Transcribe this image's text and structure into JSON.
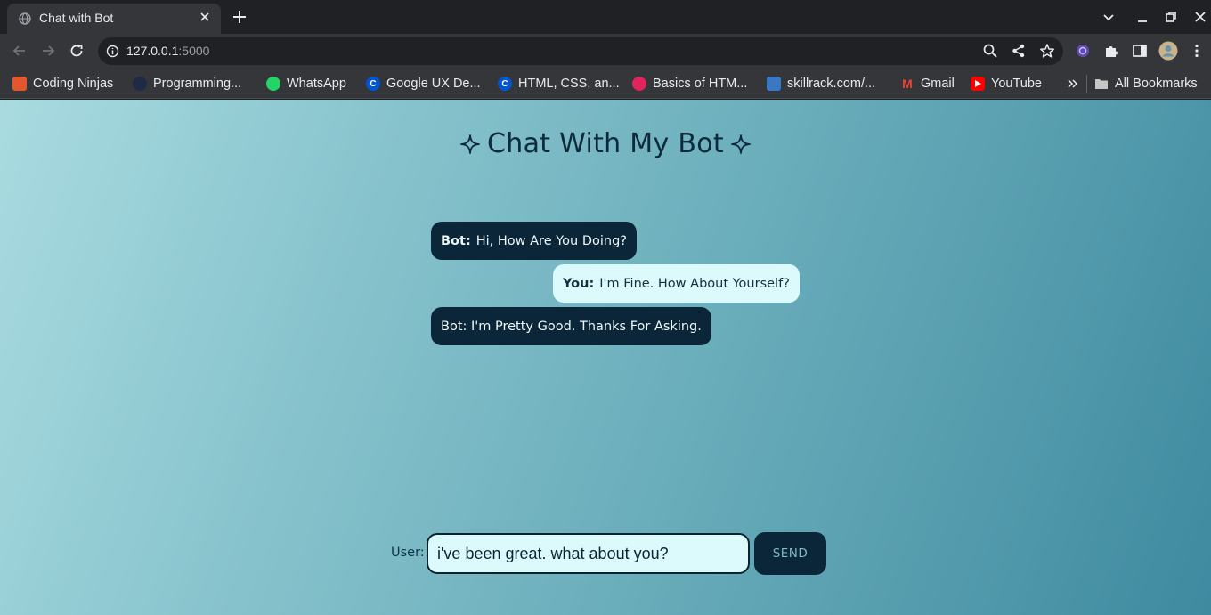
{
  "browser": {
    "tab": {
      "title": "Chat with Bot"
    },
    "address": {
      "host": "127.0.0.1",
      "port": ":5000"
    },
    "bookmarks": [
      {
        "label": "Coding Ninjas",
        "icon": "coding-ninjas-icon",
        "color": "#e2572b",
        "glyph": ""
      },
      {
        "label": "Programming...",
        "icon": "programming-icon",
        "color": "#1f2a44",
        "glyph": ""
      },
      {
        "label": "WhatsApp",
        "icon": "whatsapp-icon",
        "color": "#25d366",
        "glyph": ""
      },
      {
        "label": "Google UX De...",
        "icon": "coursera-icon",
        "color": "#0056d2",
        "glyph": "C"
      },
      {
        "label": "HTML, CSS, an...",
        "icon": "coursera-icon",
        "color": "#0056d2",
        "glyph": "C"
      },
      {
        "label": "Basics of HTM...",
        "icon": "basics-icon",
        "color": "#e0245e",
        "glyph": ""
      },
      {
        "label": "skillrack.com/...",
        "icon": "skillrack-icon",
        "color": "#3b78c4",
        "glyph": ""
      },
      {
        "label": "Gmail",
        "icon": "gmail-icon",
        "color": "#ea4335",
        "glyph": "M"
      },
      {
        "label": "YouTube",
        "icon": "youtube-icon",
        "color": "#ff0000",
        "glyph": ""
      }
    ],
    "all_bookmarks_label": "All Bookmarks"
  },
  "page": {
    "title": "Chat With My Bot",
    "messages": [
      {
        "speaker": "Bot:",
        "text": "Hi, How Are You Doing?",
        "role": "bot"
      },
      {
        "speaker": "You:",
        "text": "I'm Fine. How About Yourself?",
        "role": "user"
      },
      {
        "speaker": "",
        "text": "Bot: I'm Pretty Good. Thanks For Asking.",
        "role": "bot"
      }
    ],
    "input": {
      "label": "User:",
      "value": "i've been great. what about you?"
    },
    "send_label": "SEND"
  },
  "colors": {
    "accent": "#0b2638",
    "user_bubble": "#dcfafb",
    "page_gradient_start": "#a9dbe0",
    "page_gradient_end": "#3f8aa0"
  }
}
